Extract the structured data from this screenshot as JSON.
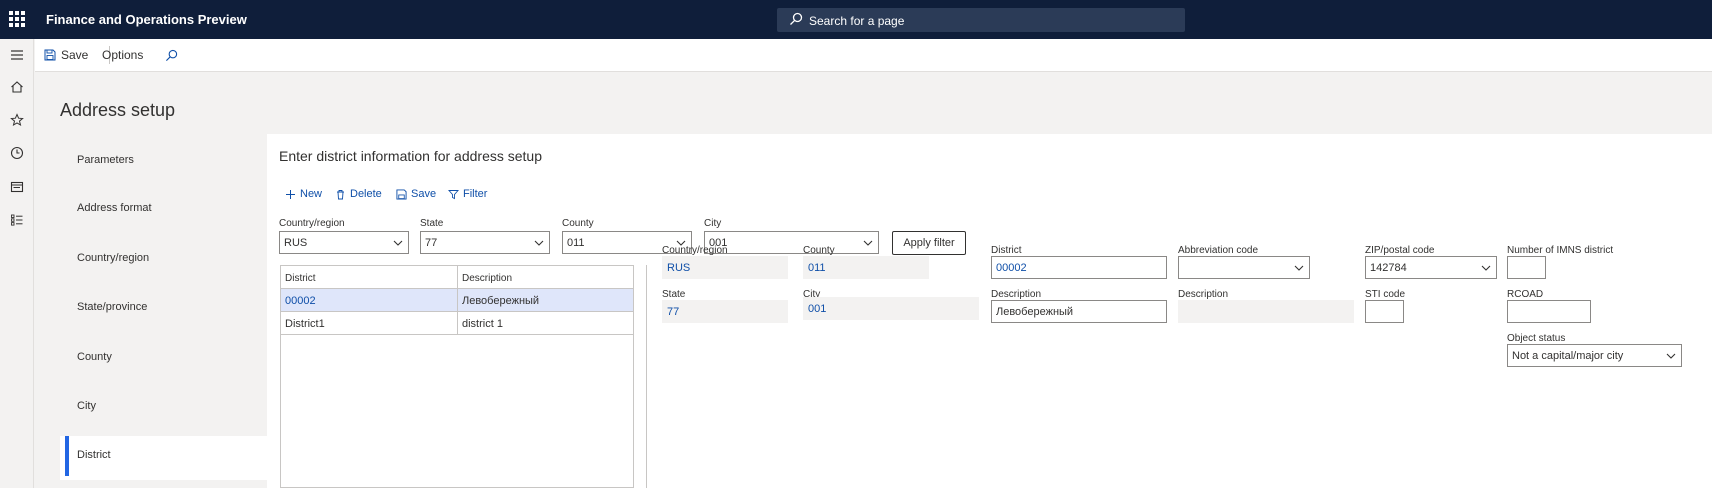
{
  "app": {
    "title": "Finance and Operations Preview",
    "search_placeholder": "Search for a page",
    "accent": "#0f1e3a",
    "link_color": "#0f4fa8"
  },
  "toolbar": {
    "save_label": "Save",
    "options_label": "Options"
  },
  "page": {
    "title": "Address setup"
  },
  "left_nav": {
    "items": [
      {
        "label": "Parameters"
      },
      {
        "label": "Address format"
      },
      {
        "label": "Country/region"
      },
      {
        "label": "State/province"
      },
      {
        "label": "County"
      },
      {
        "label": "City"
      },
      {
        "label": "District"
      }
    ],
    "selected": "District"
  },
  "main": {
    "heading": "Enter district information for address setup",
    "commands": {
      "new": "New",
      "delete": "Delete",
      "save": "Save",
      "filter": "Filter"
    },
    "filters": {
      "country": {
        "label": "Country/region",
        "value": "RUS"
      },
      "state": {
        "label": "State",
        "value": "77"
      },
      "county": {
        "label": "County",
        "value": "011"
      },
      "city": {
        "label": "City",
        "value": "001"
      },
      "apply_label": "Apply filter"
    },
    "grid": {
      "columns": [
        "District",
        "Description"
      ],
      "rows": [
        {
          "district": "00002",
          "description": "Левобережный"
        },
        {
          "district": "District1",
          "description": "district 1"
        }
      ]
    },
    "details": {
      "country": {
        "label": "Country/region",
        "value": "RUS"
      },
      "county": {
        "label": "County",
        "value": "011"
      },
      "district": {
        "label": "District",
        "value": "00002"
      },
      "abbreviation": {
        "label": "Abbreviation code",
        "value": ""
      },
      "zip": {
        "label": "ZIP/postal code",
        "value": "142784"
      },
      "imns": {
        "label": "Number of IMNS district",
        "value": ""
      },
      "state": {
        "label": "State",
        "value": "77"
      },
      "city": {
        "label": "City",
        "value": "001"
      },
      "description": {
        "label": "Description",
        "value": "Левобережный"
      },
      "description2": {
        "label": "Description",
        "value": ""
      },
      "sti": {
        "label": "STI code",
        "value": ""
      },
      "rcoad": {
        "label": "RCOAD",
        "value": ""
      },
      "object_status": {
        "label": "Object status",
        "value": "Not a capital/major city"
      }
    }
  }
}
